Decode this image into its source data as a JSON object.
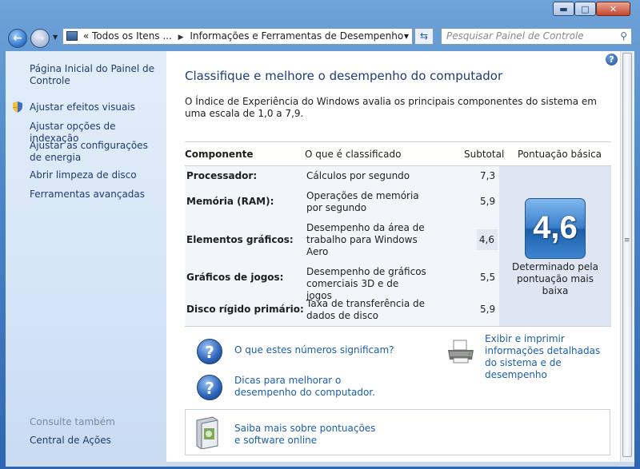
{
  "window": {
    "minimize_icon": "minimize-icon",
    "maximize_icon": "maximize-icon",
    "close_icon": "close-icon"
  },
  "nav": {
    "breadcrumb": [
      "«",
      "Todos os Itens ...",
      "Informações e Ferramentas de Desempenho"
    ],
    "search_placeholder": "Pesquisar Painel de Controle"
  },
  "sidebar": {
    "home": "Página Inicial do Painel de Controle",
    "items": [
      "Ajustar efeitos visuais",
      "Ajustar opções de indexação",
      "Ajustar as configurações de energia",
      "Abrir limpeza de disco",
      "Ferramentas avançadas"
    ],
    "see_also_title": "Consulte também",
    "see_also_items": [
      "Central de Ações"
    ]
  },
  "main": {
    "title": "Classifique e melhore o desempenho do computador",
    "description": "O Índice de Experiência do Windows avalia os principais componentes do sistema em uma escala de 1,0 a 7,9.",
    "table": {
      "headers": [
        "Componente",
        "O que é classificado",
        "Subtotal",
        "Pontuação básica"
      ],
      "rows": [
        {
          "component": "Processador:",
          "what": "Cálculos por segundo",
          "subtotal": "7,3"
        },
        {
          "component": "Memória (RAM):",
          "what": "Operações de memória por segundo",
          "subtotal": "5,9"
        },
        {
          "component": "Elementos gráficos:",
          "what": "Desempenho da área de trabalho para Windows Aero",
          "subtotal": "4,6"
        },
        {
          "component": "Gráficos de jogos:",
          "what": "Desempenho de gráficos comerciais 3D e de jogos",
          "subtotal": "5,5"
        },
        {
          "component": "Disco rígido primário:",
          "what": "Taxa de transferência de dados de disco",
          "subtotal": "5,9"
        }
      ],
      "base_score": "4,6",
      "base_score_caption": "Determinado pela pontuação mais baixa"
    },
    "links": {
      "meaning": "O que estes números significam?",
      "print": "Exibir e imprimir informações detalhadas do sistema e de desempenho",
      "tips": "Dicas para melhorar o desempenho do computador.",
      "learn_more": "Saiba mais sobre pontuações e software online"
    }
  }
}
